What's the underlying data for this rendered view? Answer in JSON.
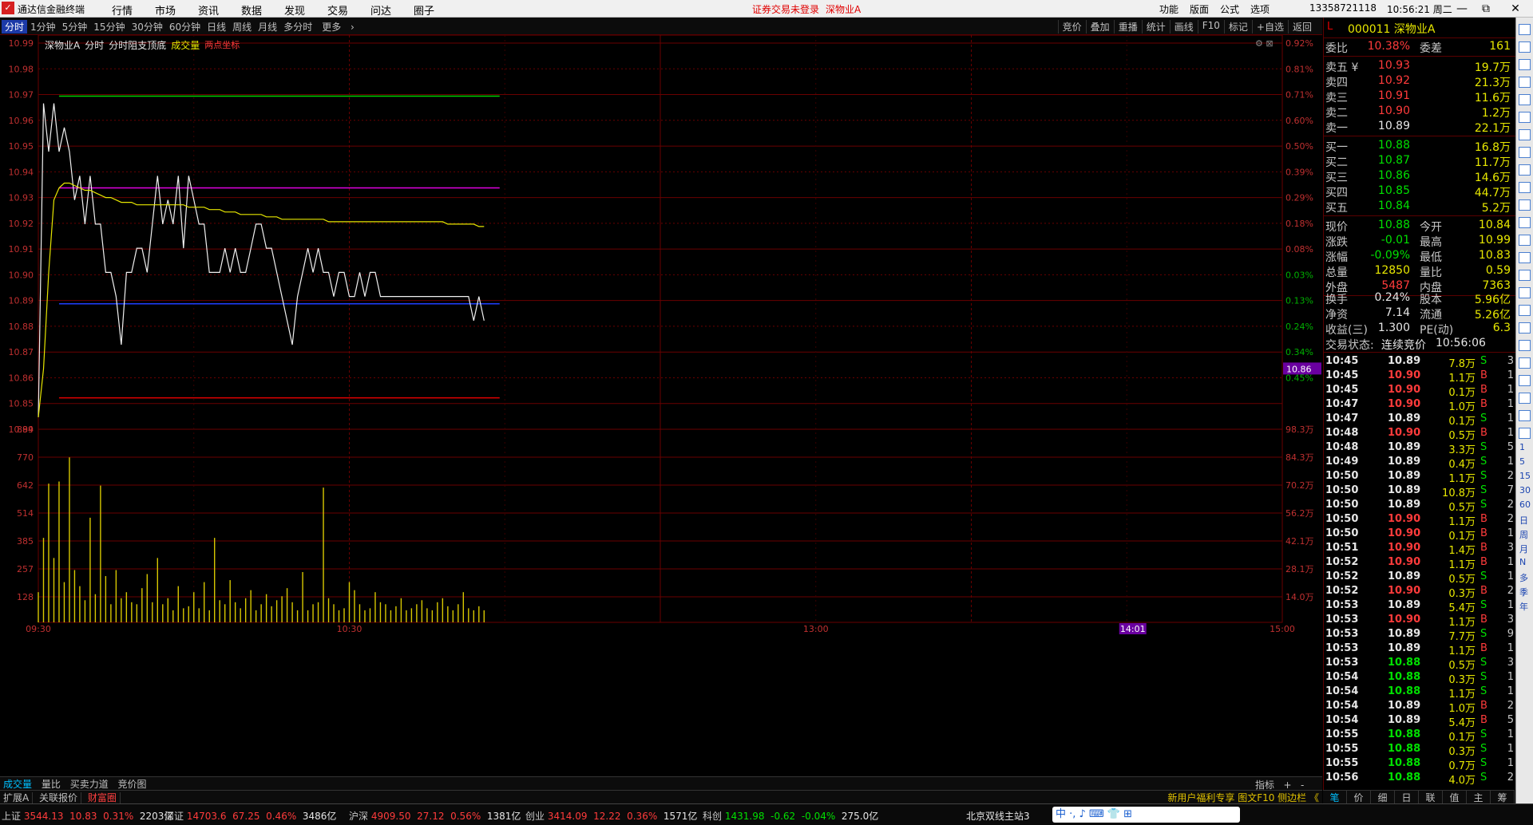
{
  "titlebar": {
    "app_name": "通达信金融终端",
    "menu": [
      "行情",
      "市场",
      "资讯",
      "数据",
      "发现",
      "交易",
      "问达",
      "圈子"
    ],
    "notice": "证券交易未登录",
    "notice_stock": "深物业A",
    "right_menu": [
      "功能",
      "版面",
      "公式",
      "选项"
    ],
    "account": "13358721118",
    "clock": "10:56:21 周二",
    "min": "—",
    "max": "☐",
    "close": "✕",
    "restore": "⧉"
  },
  "toolbar": {
    "periods": [
      "分时",
      "1分钟",
      "5分钟",
      "15分钟",
      "30分钟",
      "60分钟",
      "日线",
      "周线",
      "月线",
      "多分时",
      "更多"
    ],
    "active_period": "分时",
    "buttons": [
      "竞价",
      "叠加",
      "重播",
      "统计",
      "画线",
      "F10",
      "标记",
      "+自选",
      "返回"
    ]
  },
  "chart": {
    "legend": {
      "stock": "深物业A",
      "view": "分时",
      "indicator": "分时阻支顶底",
      "volume": "成交量",
      "extra": "两点坐标"
    },
    "price_ticks": [
      "10.99",
      "10.98",
      "10.97",
      "10.96",
      "10.95",
      "10.94",
      "10.93",
      "10.92",
      "10.91",
      "10.90",
      "10.89",
      "10.88",
      "10.87",
      "10.86",
      "10.85",
      "10.84"
    ],
    "pct_ticks": [
      "0.92%",
      "0.81%",
      "0.71%",
      "0.60%",
      "0.50%",
      "0.39%",
      "0.29%",
      "0.18%",
      "0.08%",
      "0.03%",
      "0.13%",
      "0.24%",
      "0.34%",
      "0.45%"
    ],
    "vol_ticks": [
      "899",
      "770",
      "642",
      "514",
      "385",
      "257",
      "128"
    ],
    "amount_ticks": [
      "98.3万",
      "84.3万",
      "70.2万",
      "56.2万",
      "42.1万",
      "28.1万",
      "14.0万"
    ],
    "time_ticks": [
      "09:30",
      "10:30",
      "13:00",
      "15:00"
    ],
    "cursor_time": "14:01",
    "cursor_price": "10.86",
    "level_colors": {
      "green": "#00d000",
      "magenta": "#e000e0",
      "blue": "#2040ff",
      "red": "#e00000"
    },
    "levels": {
      "green": 10.973,
      "magenta": 10.935,
      "blue": 10.887,
      "red": 10.848
    }
  },
  "chart_data": {
    "type": "line",
    "title": "深物业A",
    "x": [
      "09:30",
      "09:31",
      "09:32",
      "09:33",
      "09:34",
      "09:35",
      "09:36",
      "09:37",
      "09:38",
      "09:39",
      "09:40",
      "09:41",
      "09:42",
      "09:43",
      "09:44",
      "09:45",
      "09:46",
      "09:47",
      "09:48",
      "09:49",
      "09:50",
      "09:51",
      "09:52",
      "09:53",
      "09:54",
      "09:55",
      "09:56",
      "09:57",
      "09:58",
      "09:59",
      "10:00",
      "10:01",
      "10:02",
      "10:03",
      "10:04",
      "10:05",
      "10:06",
      "10:07",
      "10:08",
      "10:09",
      "10:10",
      "10:11",
      "10:12",
      "10:13",
      "10:14",
      "10:15",
      "10:16",
      "10:17",
      "10:18",
      "10:19",
      "10:20",
      "10:21",
      "10:22",
      "10:23",
      "10:24",
      "10:25",
      "10:26",
      "10:27",
      "10:28",
      "10:29",
      "10:30",
      "10:31",
      "10:32",
      "10:33",
      "10:34",
      "10:35",
      "10:36",
      "10:37",
      "10:38",
      "10:39",
      "10:40",
      "10:41",
      "10:42",
      "10:43",
      "10:44",
      "10:45",
      "10:46",
      "10:47",
      "10:48",
      "10:49",
      "10:50",
      "10:51",
      "10:52",
      "10:53",
      "10:54",
      "10:55",
      "10:56"
    ],
    "series": [
      {
        "name": "价格",
        "color": "#f0f0f0",
        "values": [
          10.84,
          10.97,
          10.95,
          10.97,
          10.95,
          10.96,
          10.95,
          10.93,
          10.94,
          10.92,
          10.94,
          10.92,
          10.92,
          10.9,
          10.9,
          10.89,
          10.87,
          10.9,
          10.9,
          10.91,
          10.91,
          10.9,
          10.92,
          10.94,
          10.92,
          10.93,
          10.92,
          10.94,
          10.91,
          10.94,
          10.93,
          10.92,
          10.92,
          10.9,
          10.9,
          10.9,
          10.91,
          10.9,
          10.91,
          10.9,
          10.9,
          10.91,
          10.92,
          10.92,
          10.91,
          10.91,
          10.9,
          10.89,
          10.88,
          10.87,
          10.89,
          10.9,
          10.91,
          10.9,
          10.91,
          10.9,
          10.9,
          10.89,
          10.9,
          10.9,
          10.89,
          10.89,
          10.9,
          10.89,
          10.9,
          10.9,
          10.89,
          10.89,
          10.89,
          10.89,
          10.89,
          10.89,
          10.89,
          10.89,
          10.89,
          10.89,
          10.89,
          10.89,
          10.89,
          10.89,
          10.89,
          10.89,
          10.89,
          10.89,
          10.88,
          10.89,
          10.88
        ]
      },
      {
        "name": "均价",
        "color": "#e6e600",
        "values": [
          10.84,
          10.86,
          10.9,
          10.93,
          10.935,
          10.937,
          10.937,
          10.936,
          10.935,
          10.934,
          10.934,
          10.933,
          10.932,
          10.931,
          10.931,
          10.93,
          10.929,
          10.929,
          10.929,
          10.928,
          10.928,
          10.928,
          10.928,
          10.928,
          10.928,
          10.928,
          10.928,
          10.928,
          10.928,
          10.927,
          10.927,
          10.927,
          10.927,
          10.926,
          10.926,
          10.926,
          10.925,
          10.925,
          10.925,
          10.924,
          10.924,
          10.924,
          10.924,
          10.924,
          10.923,
          10.923,
          10.923,
          10.922,
          10.922,
          10.922,
          10.922,
          10.922,
          10.922,
          10.922,
          10.922,
          10.922,
          10.921,
          10.921,
          10.921,
          10.921,
          10.921,
          10.921,
          10.921,
          10.921,
          10.921,
          10.921,
          10.921,
          10.921,
          10.921,
          10.921,
          10.921,
          10.921,
          10.921,
          10.921,
          10.921,
          10.921,
          10.921,
          10.921,
          10.921,
          10.92,
          10.92,
          10.92,
          10.92,
          10.92,
          10.92,
          10.919,
          10.919
        ]
      }
    ],
    "volume": [
      150,
      420,
      690,
      320,
      700,
      200,
      820,
      260,
      180,
      110,
      520,
      140,
      680,
      230,
      90,
      260,
      120,
      150,
      100,
      90,
      170,
      240,
      100,
      320,
      90,
      120,
      60,
      180,
      70,
      80,
      150,
      70,
      200,
      60,
      420,
      110,
      90,
      210,
      100,
      70,
      120,
      160,
      60,
      90,
      140,
      80,
      110,
      130,
      170,
      100,
      60,
      250,
      60,
      90,
      100,
      670,
      120,
      90,
      60,
      70,
      200,
      160,
      90,
      60,
      70,
      150,
      100,
      90,
      60,
      80,
      120,
      60,
      70,
      90,
      110,
      70,
      60,
      100,
      120,
      80,
      60,
      90,
      150,
      70,
      60,
      80,
      60
    ],
    "ylim": [
      10.835,
      10.995
    ],
    "volume_ylim": [
      0,
      960
    ]
  },
  "right_panel": {
    "code": "000011",
    "name": "深物业A",
    "l_marker": "L",
    "weibi_label": "委比",
    "weibi": "10.38%",
    "weicha_label": "委差",
    "weicha": "161",
    "asks": [
      {
        "label": "卖五 ¥",
        "price": "10.93",
        "vol": "19.7万"
      },
      {
        "label": "卖四",
        "price": "10.92",
        "vol": "21.3万"
      },
      {
        "label": "卖三",
        "price": "10.91",
        "vol": "11.6万"
      },
      {
        "label": "卖二",
        "price": "10.90",
        "vol": "1.2万"
      },
      {
        "label": "卖一",
        "price": "10.89",
        "vol": "22.1万"
      }
    ],
    "bids": [
      {
        "label": "买一",
        "price": "10.88",
        "vol": "16.8万"
      },
      {
        "label": "买二",
        "price": "10.87",
        "vol": "11.7万"
      },
      {
        "label": "买三",
        "price": "10.86",
        "vol": "14.6万"
      },
      {
        "label": "买四",
        "price": "10.85",
        "vol": "44.7万"
      },
      {
        "label": "买五",
        "price": "10.84",
        "vol": "5.2万"
      }
    ],
    "stats": [
      {
        "k1": "现价",
        "v1": "10.88",
        "k2": "今开",
        "v2": "10.84"
      },
      {
        "k1": "涨跌",
        "v1": "-0.01",
        "k2": "最高",
        "v2": "10.99"
      },
      {
        "k1": "涨幅",
        "v1": "-0.09%",
        "k2": "最低",
        "v2": "10.83"
      },
      {
        "k1": "总量",
        "v1": "12850",
        "k2": "量比",
        "v2": "0.59"
      },
      {
        "k1": "外盘",
        "v1": "5487",
        "k2": "内盘",
        "v2": "7363"
      }
    ],
    "stats2": [
      {
        "k1": "换手",
        "v1": "0.24%",
        "k2": "股本",
        "v2": "5.96亿"
      },
      {
        "k1": "净资",
        "v1": "7.14",
        "k2": "流通",
        "v2": "5.26亿"
      },
      {
        "k1": "收益(三)",
        "v1": "1.300",
        "k2": "PE(动)",
        "v2": "6.3"
      }
    ],
    "trade_status_label": "交易状态:",
    "trade_status": "连续竞价",
    "trade_time": "10:56:06",
    "ticks": [
      {
        "t": "10:45",
        "p": "10.89",
        "v": "7.8万",
        "bs": "S",
        "n": "3"
      },
      {
        "t": "10:45",
        "p": "10.90",
        "v": "1.1万",
        "bs": "B",
        "n": "1"
      },
      {
        "t": "10:45",
        "p": "10.90",
        "v": "0.1万",
        "bs": "B",
        "n": "1"
      },
      {
        "t": "10:47",
        "p": "10.90",
        "v": "1.0万",
        "bs": "B",
        "n": "1"
      },
      {
        "t": "10:47",
        "p": "10.89",
        "v": "0.1万",
        "bs": "S",
        "n": "1"
      },
      {
        "t": "10:48",
        "p": "10.90",
        "v": "0.5万",
        "bs": "B",
        "n": "1"
      },
      {
        "t": "10:48",
        "p": "10.89",
        "v": "3.3万",
        "bs": "S",
        "n": "5"
      },
      {
        "t": "10:49",
        "p": "10.89",
        "v": "0.4万",
        "bs": "S",
        "n": "1"
      },
      {
        "t": "10:50",
        "p": "10.89",
        "v": "1.1万",
        "bs": "S",
        "n": "2"
      },
      {
        "t": "10:50",
        "p": "10.89",
        "v": "10.8万",
        "bs": "S",
        "n": "7"
      },
      {
        "t": "10:50",
        "p": "10.89",
        "v": "0.5万",
        "bs": "S",
        "n": "2"
      },
      {
        "t": "10:50",
        "p": "10.90",
        "v": "1.1万",
        "bs": "B",
        "n": "2"
      },
      {
        "t": "10:50",
        "p": "10.90",
        "v": "0.1万",
        "bs": "B",
        "n": "1"
      },
      {
        "t": "10:51",
        "p": "10.90",
        "v": "1.4万",
        "bs": "B",
        "n": "3"
      },
      {
        "t": "10:52",
        "p": "10.90",
        "v": "1.1万",
        "bs": "B",
        "n": "1"
      },
      {
        "t": "10:52",
        "p": "10.89",
        "v": "0.5万",
        "bs": "S",
        "n": "1"
      },
      {
        "t": "10:52",
        "p": "10.90",
        "v": "0.3万",
        "bs": "B",
        "n": "2"
      },
      {
        "t": "10:53",
        "p": "10.89",
        "v": "5.4万",
        "bs": "S",
        "n": "1"
      },
      {
        "t": "10:53",
        "p": "10.90",
        "v": "1.1万",
        "bs": "B",
        "n": "3"
      },
      {
        "t": "10:53",
        "p": "10.89",
        "v": "7.7万",
        "bs": "S",
        "n": "9"
      },
      {
        "t": "10:53",
        "p": "10.89",
        "v": "1.1万",
        "bs": "B",
        "n": "1"
      },
      {
        "t": "10:53",
        "p": "10.88",
        "v": "0.5万",
        "bs": "S",
        "n": "3"
      },
      {
        "t": "10:54",
        "p": "10.88",
        "v": "0.3万",
        "bs": "S",
        "n": "1"
      },
      {
        "t": "10:54",
        "p": "10.88",
        "v": "1.1万",
        "bs": "S",
        "n": "1"
      },
      {
        "t": "10:54",
        "p": "10.89",
        "v": "1.0万",
        "bs": "B",
        "n": "2"
      },
      {
        "t": "10:54",
        "p": "10.89",
        "v": "5.4万",
        "bs": "B",
        "n": "5"
      },
      {
        "t": "10:55",
        "p": "10.88",
        "v": "0.1万",
        "bs": "S",
        "n": "1"
      },
      {
        "t": "10:55",
        "p": "10.88",
        "v": "0.3万",
        "bs": "S",
        "n": "1"
      },
      {
        "t": "10:55",
        "p": "10.88",
        "v": "0.7万",
        "bs": "S",
        "n": "1"
      },
      {
        "t": "10:56",
        "p": "10.88",
        "v": "4.0万",
        "bs": "S",
        "n": "2"
      }
    ],
    "tabs": [
      "笔",
      "价",
      "细",
      "日",
      "联",
      "值",
      "主",
      "筹"
    ]
  },
  "bottom_tabs": {
    "row1": [
      "成交量",
      "量比",
      "买卖力道",
      "竞价图"
    ],
    "row2": [
      "扩展A",
      "关联报价",
      "财富圈"
    ],
    "right": "新用户福利专享 图文F10 侧边栏 《",
    "indicator_btn": "指标",
    "plus": "+",
    "minus": "-"
  },
  "sidebar_labels": [
    "1",
    "5",
    "15",
    "30",
    "60",
    "日",
    "周",
    "月",
    "N",
    "多",
    "季",
    "年"
  ],
  "status": {
    "items": [
      {
        "name": "上证",
        "price": "3544.13",
        "chg": "10.83",
        "pct": "0.31%",
        "amt": "2203亿"
      },
      {
        "name": "深证",
        "price": "14703.6",
        "chg": "67.25",
        "pct": "0.46%",
        "amt": "3486亿"
      },
      {
        "name": "沪深",
        "price": "4909.50",
        "chg": "27.12",
        "pct": "0.56%",
        "amt": "1381亿"
      },
      {
        "name": "创业",
        "price": "3414.09",
        "chg": "12.22",
        "pct": "0.36%",
        "amt": "1571亿"
      },
      {
        "name": "科创",
        "price": "1431.98",
        "chg": "-0.62",
        "pct": "-0.04%",
        "amt": "275.0亿"
      }
    ],
    "server": "北京双线主站3",
    "ime": "中 ·, ♪ ⌨ 👕 ⊞"
  }
}
